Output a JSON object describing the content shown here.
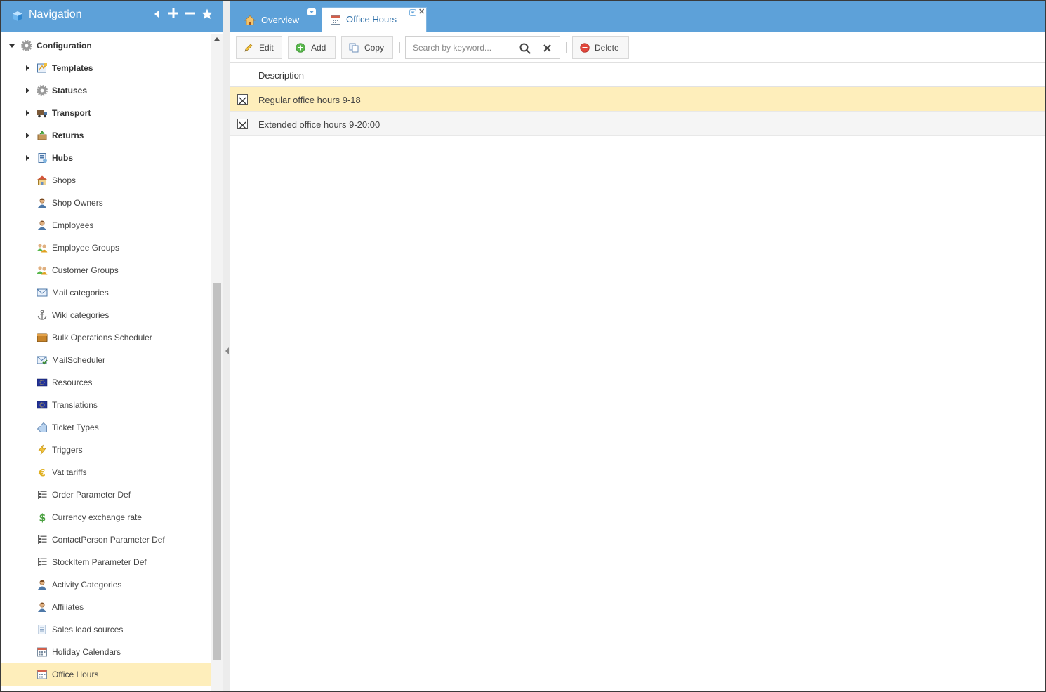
{
  "nav": {
    "title": "Navigation",
    "tree": [
      {
        "label": "Configuration",
        "icon": "gear-icon",
        "level": 0,
        "expandable": true,
        "expanded": true,
        "bold": true
      },
      {
        "label": "Templates",
        "icon": "template-icon",
        "level": 1,
        "expandable": true,
        "bold": true
      },
      {
        "label": "Statuses",
        "icon": "gear-icon",
        "level": 1,
        "expandable": true,
        "bold": true
      },
      {
        "label": "Transport",
        "icon": "truck-icon",
        "level": 1,
        "expandable": true,
        "bold": true
      },
      {
        "label": "Returns",
        "icon": "returns-icon",
        "level": 1,
        "expandable": true,
        "bold": true
      },
      {
        "label": "Hubs",
        "icon": "hub-icon",
        "level": 1,
        "expandable": true,
        "bold": true
      },
      {
        "label": "Shops",
        "icon": "shop-icon",
        "level": 1
      },
      {
        "label": "Shop Owners",
        "icon": "person-icon",
        "level": 1
      },
      {
        "label": "Employees",
        "icon": "person-icon",
        "level": 1
      },
      {
        "label": "Employee Groups",
        "icon": "group-icon",
        "level": 1
      },
      {
        "label": "Customer Groups",
        "icon": "group-icon",
        "level": 1
      },
      {
        "label": "Mail categories",
        "icon": "mail-icon",
        "level": 1
      },
      {
        "label": "Wiki categories",
        "icon": "anchor-icon",
        "level": 1
      },
      {
        "label": "Bulk Operations Scheduler",
        "icon": "box-icon",
        "level": 1
      },
      {
        "label": "MailScheduler",
        "icon": "mail-check-icon",
        "level": 1
      },
      {
        "label": "Resources",
        "icon": "flag-icon",
        "level": 1
      },
      {
        "label": "Translations",
        "icon": "flag-icon",
        "level": 1
      },
      {
        "label": "Ticket Types",
        "icon": "tag-icon",
        "level": 1
      },
      {
        "label": "Triggers",
        "icon": "lightning-icon",
        "level": 1
      },
      {
        "label": "Vat tariffs",
        "icon": "euro-icon",
        "level": 1
      },
      {
        "label": "Order Parameter Def",
        "icon": "list-icon",
        "level": 1
      },
      {
        "label": "Currency exchange rate",
        "icon": "dollar-icon",
        "level": 1
      },
      {
        "label": "ContactPerson Parameter Def",
        "icon": "list-icon",
        "level": 1
      },
      {
        "label": "StockItem Parameter Def",
        "icon": "list-icon",
        "level": 1
      },
      {
        "label": "Activity Categories",
        "icon": "person-icon",
        "level": 1
      },
      {
        "label": "Affiliates",
        "icon": "person-icon",
        "level": 1
      },
      {
        "label": "Sales lead sources",
        "icon": "document-icon",
        "level": 1
      },
      {
        "label": "Holiday Calendars",
        "icon": "calendar-icon",
        "level": 1
      },
      {
        "label": "Office Hours",
        "icon": "calendar-icon",
        "level": 1,
        "selected": true
      }
    ]
  },
  "tabs": {
    "overview": "Overview",
    "active": "Office Hours"
  },
  "toolbar": {
    "edit": "Edit",
    "add": "Add",
    "copy": "Copy",
    "delete": "Delete",
    "search_placeholder": "Search by keyword..."
  },
  "grid": {
    "column": "Description",
    "rows": [
      {
        "description": "Regular office hours 9-18",
        "selected": true
      },
      {
        "description": "Extended office hours 9-20:00",
        "selected": false
      }
    ]
  },
  "colors": {
    "header_blue": "#5da1d9",
    "selection": "#feeebb",
    "active_tab_text": "#2e6fa8"
  }
}
